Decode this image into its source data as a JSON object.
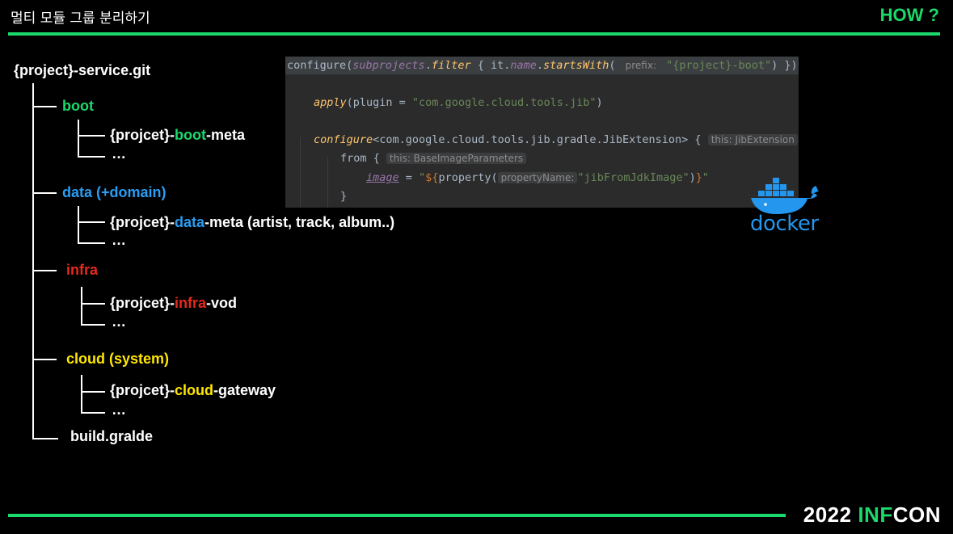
{
  "header": {
    "title": "멀티 모듈 그룹 분리하기",
    "section": "HOW ?"
  },
  "tree": {
    "root": "{project}-service.git",
    "boot": {
      "label": "boot",
      "child_prefix": "{projcet}-",
      "child_highlight": "boot",
      "child_suffix": "-meta",
      "more": "…"
    },
    "data": {
      "label": "data (+domain)",
      "child_prefix": "{projcet}-",
      "child_highlight": "data",
      "child_suffix": "-meta (artist, track, album..)",
      "more": "…"
    },
    "infra": {
      "label": "infra",
      "child_prefix": "{projcet}-",
      "child_highlight": "infra",
      "child_suffix": "-vod",
      "more": "…"
    },
    "cloud": {
      "label": "cloud (system)",
      "child_prefix": "{projcet}-",
      "child_highlight": "cloud",
      "child_suffix": "-gateway",
      "more": "…"
    },
    "build": "build.gralde"
  },
  "code": {
    "l1_a": "configure(",
    "l1_b": "subprojects",
    "l1_c": ".",
    "l1_d": "filter",
    "l1_e": " { it.",
    "l1_f": "name",
    "l1_g": ".",
    "l1_h": "startsWith",
    "l1_i": "(",
    "l1_hint": "prefix:",
    "l1_str": "\"{project}-boot\"",
    "l1_end": ") })",
    "l2_fn": "apply",
    "l2_a": "(plugin = ",
    "l2_str": "\"com.google.cloud.tools.jib\"",
    "l2_end": ")",
    "l3_fn": "configure",
    "l3_a": "<com.google.cloud.tools.jib.gradle.JibExtension> {",
    "l3_hint": "this: JibExtension",
    "l4_a": "from {",
    "l4_hint": "this: BaseImageParameters",
    "l5_prop": "image",
    "l5_a": " = ",
    "l5_str1": "\"",
    "l5_tpl": "${",
    "l5_b": "property(",
    "l5_hint": "propertyName:",
    "l5_str2": "\"jibFromJdkImage\"",
    "l5_c": ")",
    "l5_tplend": "}",
    "l5_str3": "\"",
    "l6_a": "}"
  },
  "docker": {
    "label": "docker",
    "color": "#2496ed"
  },
  "footer": {
    "year": "2022",
    "brand_a": "INF",
    "brand_b": "CON"
  },
  "colors": {
    "accent": "#1bd96a",
    "data": "#2a9df4",
    "infra": "#e8291c",
    "cloud": "#ffe600"
  }
}
